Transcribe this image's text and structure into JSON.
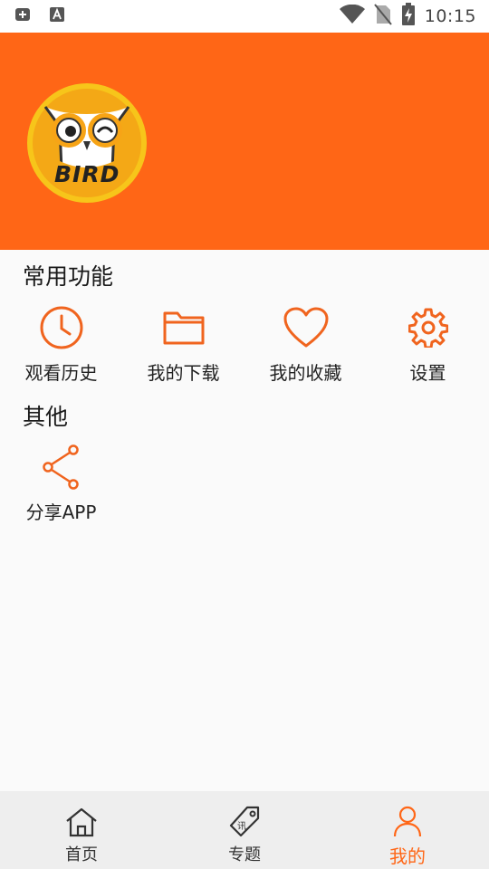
{
  "status_bar": {
    "time": "10:15",
    "icons": [
      "add-box-icon",
      "font-a-icon",
      "wifi-icon",
      "no-sim-icon",
      "battery-charging-icon"
    ]
  },
  "profile": {
    "logo_text": "BIRD",
    "brand_color": "#ff6616"
  },
  "common": {
    "title": "常用功能",
    "items": [
      {
        "label": "观看历史",
        "icon": "clock-icon"
      },
      {
        "label": "我的下载",
        "icon": "folder-icon"
      },
      {
        "label": "我的收藏",
        "icon": "heart-icon"
      },
      {
        "label": "设置",
        "icon": "gear-icon"
      }
    ]
  },
  "other": {
    "title": "其他",
    "items": [
      {
        "label": "分享APP",
        "icon": "share-icon"
      }
    ]
  },
  "bottom_nav": {
    "items": [
      {
        "label": "首页",
        "icon": "home-icon",
        "active": false
      },
      {
        "label": "专题",
        "icon": "tag-icon",
        "active": false
      },
      {
        "label": "我的",
        "icon": "user-icon",
        "active": true
      }
    ],
    "active_color": "#ff6616"
  }
}
